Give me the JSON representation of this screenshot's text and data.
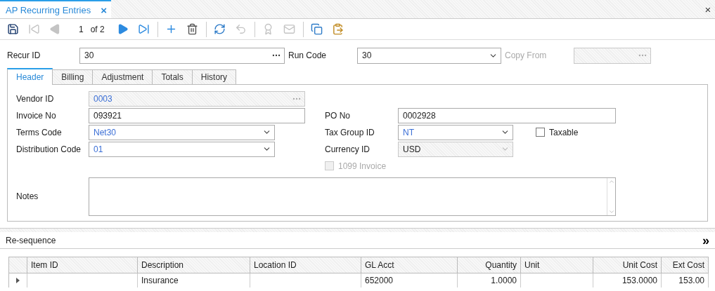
{
  "document_tab": {
    "title": "AP Recurring Entries",
    "close": "×"
  },
  "toolbar": [
    {
      "kind": "save",
      "disabled": false
    },
    {
      "kind": "first",
      "disabled": true
    },
    {
      "kind": "prev",
      "disabled": true
    },
    {
      "kind": "page",
      "text": "1"
    },
    {
      "kind": "count",
      "text": "of 2"
    },
    {
      "kind": "next",
      "disabled": false
    },
    {
      "kind": "last",
      "disabled": false
    },
    {
      "kind": "sep"
    },
    {
      "kind": "add",
      "disabled": false
    },
    {
      "kind": "delete",
      "disabled": false
    },
    {
      "kind": "sep"
    },
    {
      "kind": "refresh",
      "disabled": false
    },
    {
      "kind": "undo",
      "disabled": true
    },
    {
      "kind": "sep"
    },
    {
      "kind": "award",
      "disabled": true
    },
    {
      "kind": "mail",
      "disabled": true
    },
    {
      "kind": "sep"
    },
    {
      "kind": "copy",
      "disabled": false
    },
    {
      "kind": "paste",
      "disabled": false
    }
  ],
  "top_fields": [
    {
      "label": "Recur ID",
      "value": "30",
      "kind": "lookup",
      "disabled": false,
      "linked": false
    },
    {
      "label": "Run Code",
      "value": "30",
      "kind": "dropdown",
      "disabled": false,
      "linked": false
    },
    {
      "label": "Copy From",
      "kind": "lookup",
      "disabled": true,
      "linked": false
    }
  ],
  "tabs": [
    {
      "label": "Header",
      "selected": true
    },
    {
      "label": "Billing",
      "selected": false
    },
    {
      "label": "Adjustment",
      "selected": false
    },
    {
      "label": "Totals",
      "selected": false
    },
    {
      "label": "History",
      "selected": false
    }
  ],
  "header": {
    "left": [
      {
        "label": "Vendor ID",
        "value": "0003",
        "kind": "lookup",
        "disabled": true,
        "linked": true
      },
      {
        "label": "Invoice No",
        "value": "093921",
        "kind": "text",
        "disabled": false,
        "linked": false
      },
      {
        "label": "Terms Code",
        "value": "Net30",
        "kind": "dropdown",
        "disabled": false,
        "linked": true
      },
      {
        "label": "Distribution Code",
        "value": "01",
        "kind": "dropdown",
        "disabled": false,
        "linked": true
      }
    ],
    "right": [
      {
        "label": "PO No",
        "value": "0002928",
        "kind": "text",
        "disabled": false,
        "linked": false
      },
      {
        "label": "Tax Group ID",
        "value": "NT",
        "kind": "dropdown",
        "disabled": false,
        "linked": true
      },
      {
        "label": "Currency ID",
        "value": "USD",
        "kind": "dropdown",
        "disabled": true,
        "linked": false
      }
    ],
    "taxable": {
      "label": "Taxable",
      "checked": false,
      "disabled": false
    },
    "invoice_1099": {
      "label": "1099 Invoice",
      "checked": false,
      "disabled": true
    },
    "notes": {
      "label": "Notes"
    }
  },
  "resequence": {
    "label": "Re-sequence",
    "expand": "»"
  },
  "table": {
    "columns": [
      "Item ID",
      "Description",
      "Location ID",
      "GL Acct",
      "Quantity",
      "Unit",
      "Unit Cost",
      "Ext Cost"
    ],
    "rows": [
      {
        "current": true,
        "cells": [
          "",
          "Insurance",
          "",
          "652000",
          "1.0000",
          "",
          "153.0000",
          "153.00"
        ]
      }
    ]
  }
}
